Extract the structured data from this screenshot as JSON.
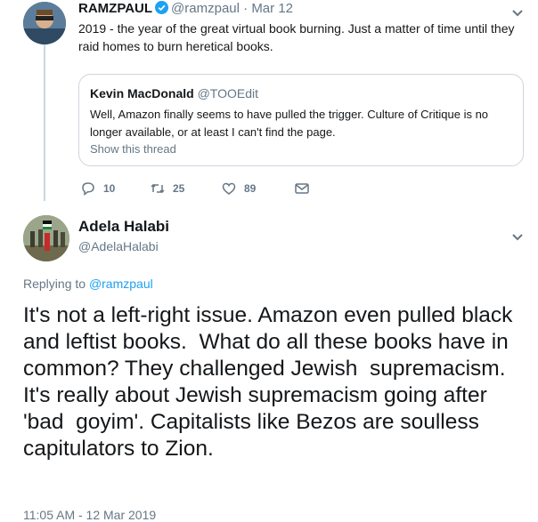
{
  "tweet1": {
    "display_name": "RAMZPAUL",
    "handle": "@ramzpaul",
    "separator": "·",
    "date": "Mar 12",
    "text": "2019 - the year of the great virtual book burning. Just a matter of time until they raid homes to burn heretical books.",
    "quoted": {
      "display_name": "Kevin MacDonald",
      "handle": "@TOOEdit",
      "text": "Well, Amazon finally seems to have pulled the trigger. Culture of Critique is no longer available, or at least I can't find the page.",
      "show_thread": "Show this thread"
    },
    "actions": {
      "replies": "10",
      "retweets": "25",
      "likes": "89"
    }
  },
  "tweet2": {
    "display_name": "Adela Halabi",
    "handle": "@AdelaHalabi",
    "replying_prefix": "Replying to",
    "replying_to": "@ramzpaul",
    "text": "It's not a left-right issue. Amazon even pulled black and leftist books.  What do all these books have in common? They challenged Jewish  supremacism. It's really about Jewish supremacism going after 'bad  goyim'. Capitalists like Bezos are soulless capitulators to Zion.",
    "timestamp": "11:05 AM - 12 Mar 2019"
  },
  "colors": {
    "link": "#1da1f2",
    "muted": "#657786",
    "border": "#ccd6dd",
    "text": "#14171a"
  },
  "icons": [
    "verified-badge-icon",
    "reply-icon",
    "retweet-icon",
    "like-icon",
    "direct-message-icon",
    "chevron-down-icon"
  ]
}
